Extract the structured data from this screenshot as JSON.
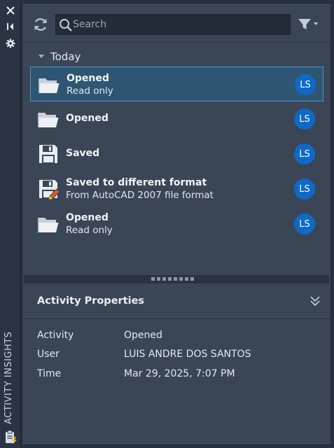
{
  "sidebar_strip": {
    "title": "ACTIVITY INSIGHTS",
    "buttons": [
      {
        "name": "close-icon"
      },
      {
        "name": "collapse-panel-icon"
      },
      {
        "name": "gear-icon"
      }
    ],
    "app_icon": "clipboard-lightning-icon"
  },
  "toolbar": {
    "refresh_icon": "refresh-icon",
    "search": {
      "placeholder": "Search",
      "value": ""
    },
    "filter_icon": "filter-icon"
  },
  "group": {
    "label": "Today",
    "expanded": true
  },
  "activities": [
    {
      "icon": "folder-open-icon",
      "title": "Opened",
      "subtitle": "Read only",
      "user_initials": "LS",
      "selected": true
    },
    {
      "icon": "folder-open-icon",
      "title": "Opened",
      "subtitle": "",
      "user_initials": "LS",
      "selected": false
    },
    {
      "icon": "floppy-disk-icon",
      "title": "Saved",
      "subtitle": "",
      "user_initials": "LS",
      "selected": false
    },
    {
      "icon": "floppy-disk-edit-icon",
      "title": "Saved to different format",
      "subtitle": "From AutoCAD 2007 file format",
      "user_initials": "LS",
      "selected": false
    },
    {
      "icon": "folder-open-icon",
      "title": "Opened",
      "subtitle": "Read only",
      "user_initials": "LS",
      "selected": false
    }
  ],
  "properties": {
    "title": "Activity Properties",
    "rows": [
      {
        "key": "Activity",
        "value": "Opened"
      },
      {
        "key": "User",
        "value": "LUIS ANDRE DOS SANTOS"
      },
      {
        "key": "Time",
        "value": "Mar 29, 2025, 7:07 PM"
      }
    ]
  },
  "colors": {
    "panel_bg": "#3a4556",
    "selected_bg": "#2e5672",
    "selected_border": "#4b93bf",
    "avatar_bg": "#0f69c8"
  }
}
